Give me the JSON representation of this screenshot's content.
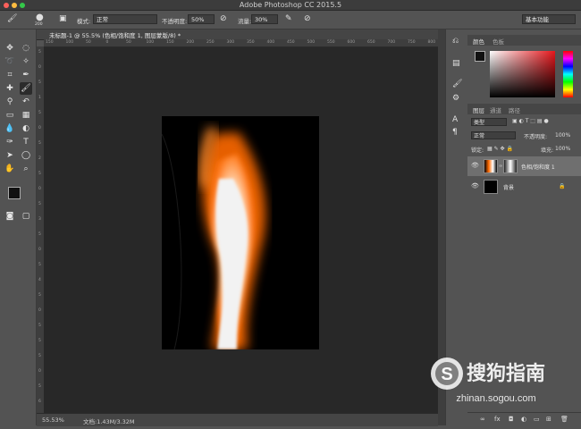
{
  "window": {
    "title": "Adobe Photoshop CC 2015.5"
  },
  "options_bar": {
    "brush_size": "200",
    "mode_label": "模式:",
    "mode_value": "正常",
    "opacity_label": "不透明度:",
    "opacity_value": "50%",
    "flow_label": "流量:",
    "flow_value": "30%",
    "workspace": "基本功能"
  },
  "document": {
    "tab_title": "未标题-1 @ 55.5% (色相/饱和度 1, 图层蒙版/8) *",
    "ruler_h": [
      "150",
      "100",
      "50",
      "0",
      "50",
      "100",
      "150",
      "200",
      "250",
      "300",
      "350",
      "400",
      "450",
      "500",
      "550",
      "600",
      "650",
      "700",
      "750",
      "800"
    ],
    "ruler_v": [
      "5",
      "0",
      "5",
      "1",
      "5",
      "0",
      "5",
      "2",
      "5",
      "0",
      "5",
      "3",
      "5",
      "0",
      "5",
      "4",
      "5",
      "0",
      "5",
      "5",
      "5",
      "0",
      "5",
      "6"
    ]
  },
  "status": {
    "zoom": "55.53%",
    "doc_size": "文档:1.43M/3.32M"
  },
  "color_panel": {
    "tab_color": "颜色",
    "tab_swatches": "色板"
  },
  "layers_panel": {
    "tab_layers": "图层",
    "tab_channels": "通道",
    "tab_paths": "路径",
    "filter_type": "类型",
    "blend_mode": "正常",
    "opacity_label": "不透明度:",
    "opacity_value": "100%",
    "lock_label": "锁定:",
    "fill_label": "填充:",
    "fill_value": "100%",
    "layers": [
      {
        "name": "色相/饱和度 1"
      },
      {
        "name": "背景"
      }
    ]
  },
  "watermark": {
    "brand": "搜狗指南",
    "url": "zhinan.sogou.com"
  }
}
